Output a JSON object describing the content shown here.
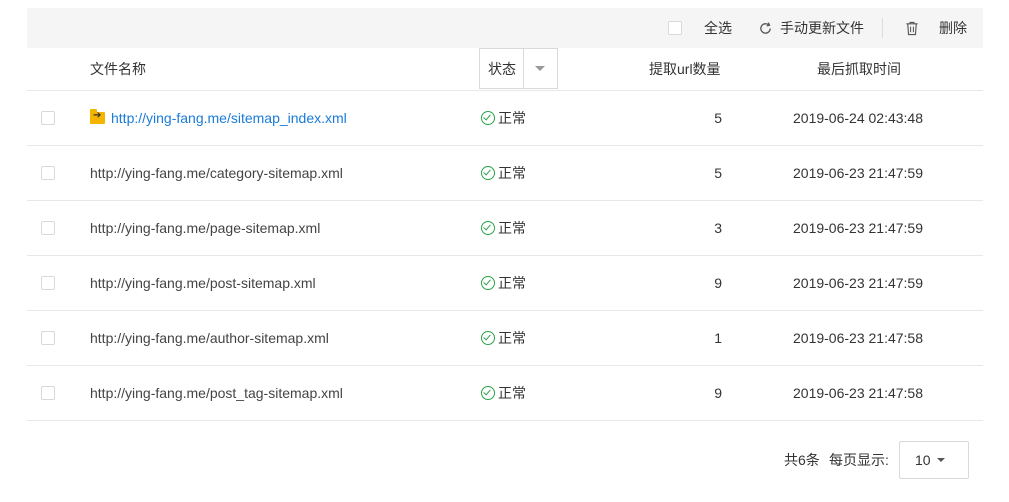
{
  "toolbar": {
    "select_all_label": "全选",
    "refresh_label": "手动更新文件",
    "delete_label": "删除"
  },
  "table": {
    "headers": {
      "name": "文件名称",
      "status": "状态",
      "count": "提取url数量",
      "time": "最后抓取时间"
    },
    "rows": [
      {
        "name": "http://ying-fang.me/sitemap_index.xml",
        "status": "正常",
        "count": "5",
        "time": "2019-06-24 02:43:48"
      },
      {
        "name": "http://ying-fang.me/category-sitemap.xml",
        "status": "正常",
        "count": "5",
        "time": "2019-06-23 21:47:59"
      },
      {
        "name": "http://ying-fang.me/page-sitemap.xml",
        "status": "正常",
        "count": "3",
        "time": "2019-06-23 21:47:59"
      },
      {
        "name": "http://ying-fang.me/post-sitemap.xml",
        "status": "正常",
        "count": "9",
        "time": "2019-06-23 21:47:59"
      },
      {
        "name": "http://ying-fang.me/author-sitemap.xml",
        "status": "正常",
        "count": "1",
        "time": "2019-06-23 21:47:58"
      },
      {
        "name": "http://ying-fang.me/post_tag-sitemap.xml",
        "status": "正常",
        "count": "9",
        "time": "2019-06-23 21:47:58"
      }
    ]
  },
  "pagination": {
    "total_label": "共6条",
    "per_page_label": "每页显示:",
    "page_size": "10"
  },
  "colors": {
    "link": "#1a7bd9",
    "status_ok": "#2aa34a",
    "toolbar_bg": "#f5f5f5"
  }
}
